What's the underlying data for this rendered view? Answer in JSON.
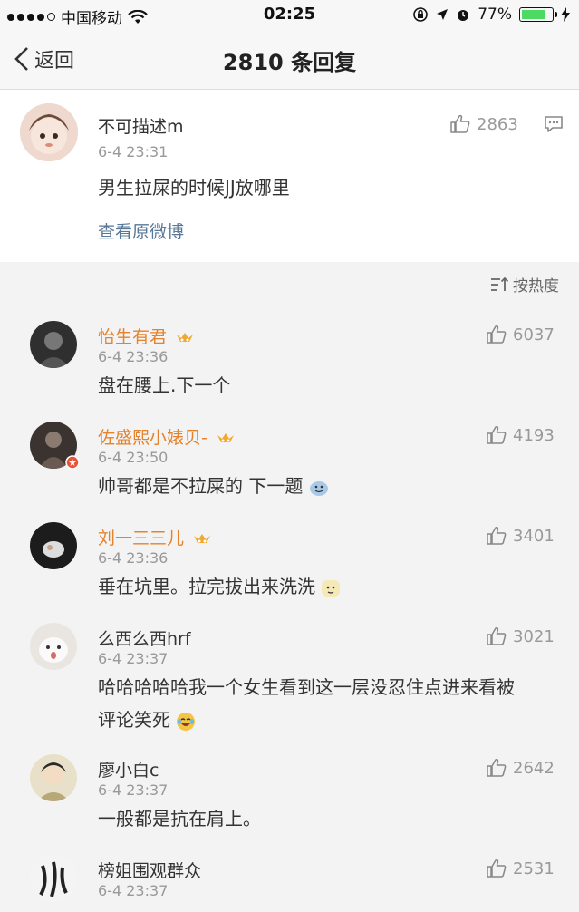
{
  "status_bar": {
    "carrier": "中国移动",
    "time": "02:25",
    "battery": "77%",
    "battery_level": 0.77
  },
  "nav": {
    "back_label": "返回",
    "title": "2810 条回复"
  },
  "post": {
    "author": "不可描述m",
    "time": "6-4 23:31",
    "likes": "2863",
    "content": "男生拉屎的时候JJ放哪里",
    "view_original": "查看原微博"
  },
  "sort_label": "按热度",
  "comments": [
    {
      "author": "怡生有君",
      "time": "6-4 23:36",
      "likes": "6037",
      "content": "盘在腰上.下一个"
    },
    {
      "author": "佐盛熙小婊贝-",
      "time": "6-4 23:50",
      "likes": "4193",
      "content": "帅哥都是不拉屎的 下一题"
    },
    {
      "author": "刘一三三儿",
      "time": "6-4 23:36",
      "likes": "3401",
      "content": "垂在坑里。拉完拔出来洗洗"
    },
    {
      "author": "么西么西hrf",
      "time": "6-4 23:37",
      "likes": "3021",
      "content_line1": "哈哈哈哈哈我一个女生看到这一层没忍住点进来看被",
      "content_line2": "评论笑死"
    },
    {
      "author": "廖小白c",
      "time": "6-4 23:37",
      "likes": "2642",
      "content": "一般都是抗在肩上。"
    },
    {
      "author": "榜姐围观群众",
      "time": "6-4 23:37",
      "likes": "2531"
    }
  ],
  "colors": {
    "vip_name": "#e4832e",
    "link": "#587897",
    "muted": "#999999"
  }
}
